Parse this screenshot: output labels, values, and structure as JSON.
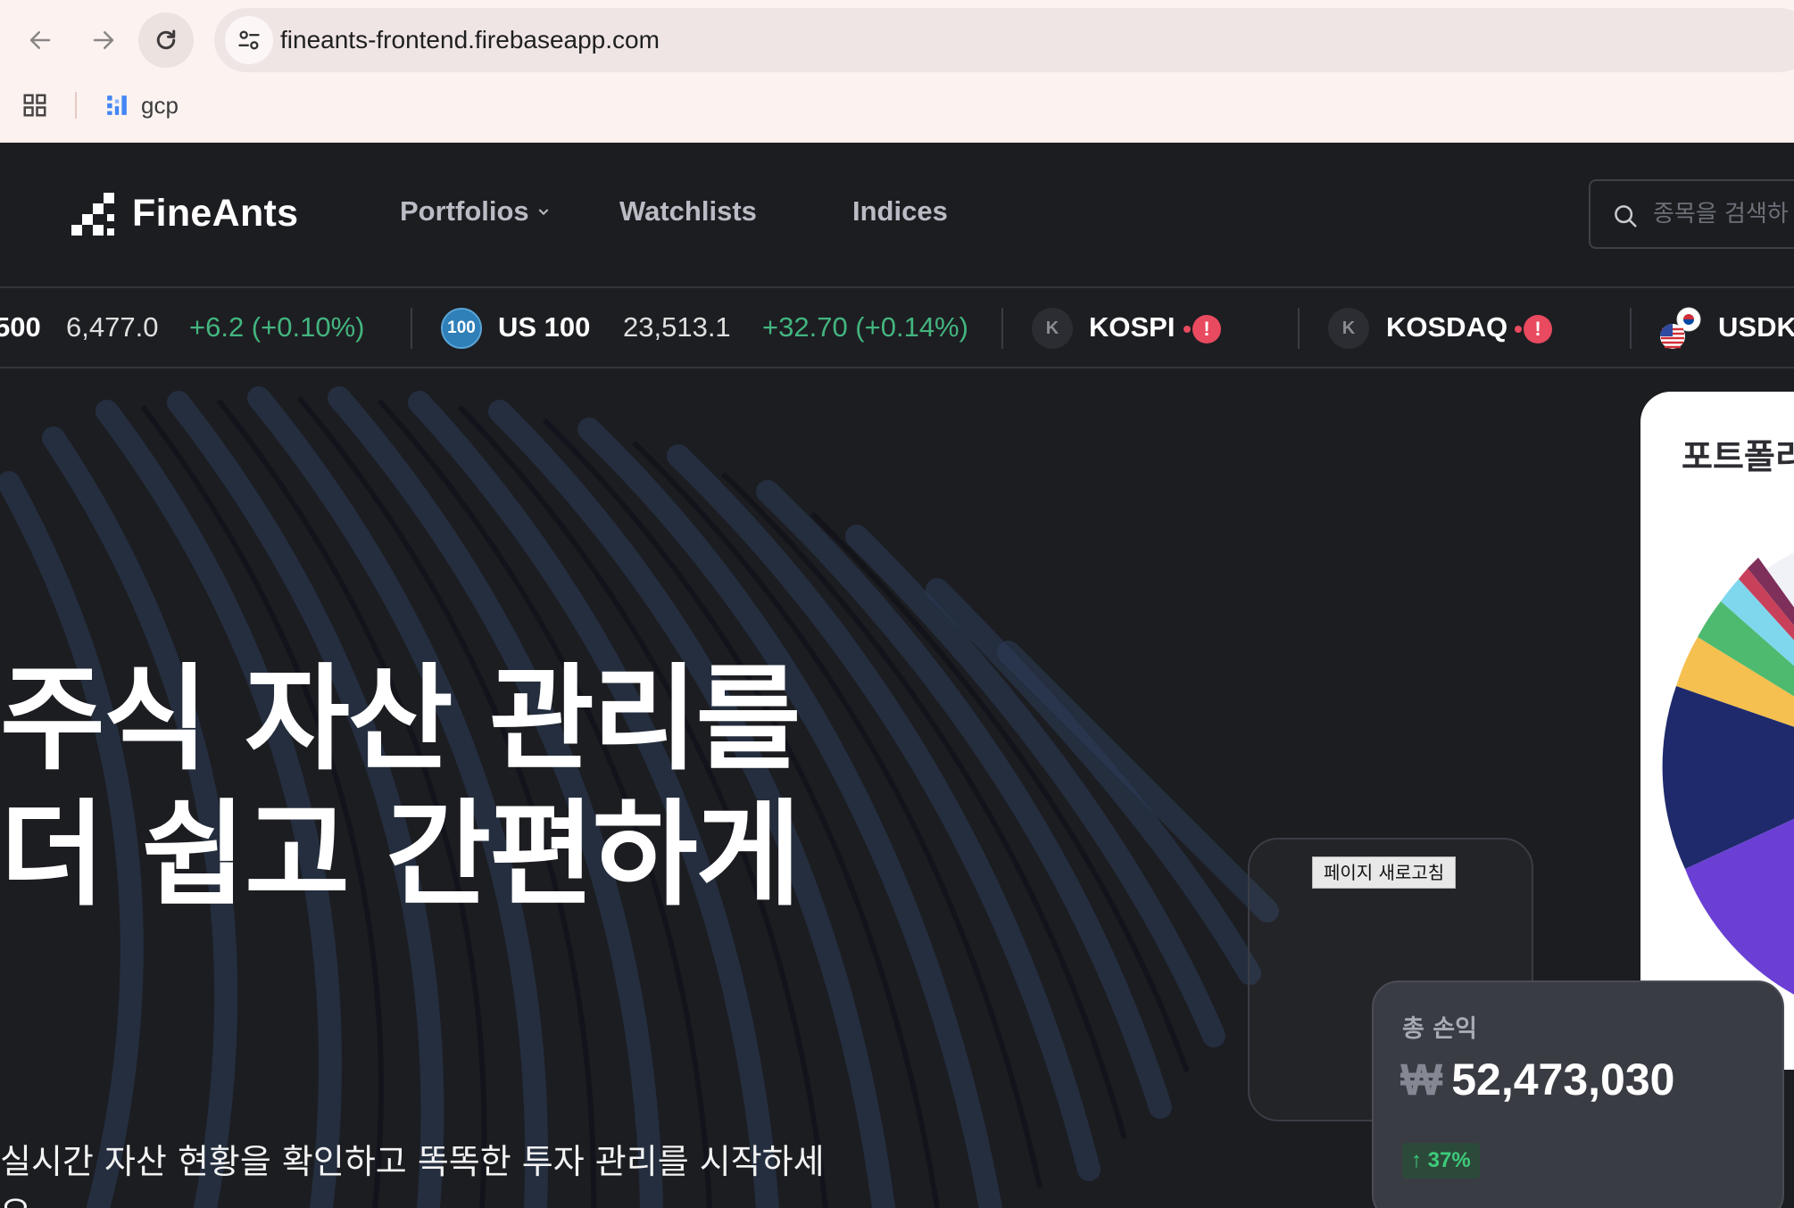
{
  "browser": {
    "url": "fineants-frontend.firebaseapp.com",
    "bookmarks": [
      {
        "label": "gcp"
      }
    ]
  },
  "header": {
    "logo_text": "FineAnts",
    "menu": [
      {
        "label": "Portfolios"
      },
      {
        "label": "Watchlists"
      },
      {
        "label": "Indices"
      }
    ],
    "search_placeholder": "종목을 검색하"
  },
  "ticker": [
    {
      "name": "500",
      "value": "6,477.0",
      "change": "+6.2 (+0.10%)"
    },
    {
      "badge": "100",
      "name": "US 100",
      "value": "23,513.1",
      "change": "+32.70 (+0.14%)"
    },
    {
      "badge": "K",
      "name": "KOSPI",
      "alert": "!"
    },
    {
      "badge": "K",
      "name": "KOSDAQ",
      "alert": "!"
    },
    {
      "name": "USDK"
    }
  ],
  "hero": {
    "title_line1": "주식 자산 관리를",
    "title_line2": "더 쉽고 간편하게",
    "subtitle_line1": "실시간 자산 현황을 확인하고 똑똑한 투자 관리를 시작하세",
    "subtitle_line2": "요"
  },
  "portfolio_card": {
    "title": "포트폴리"
  },
  "refresh_button": "페이지 새로고침",
  "pl_card": {
    "label": "총 손익",
    "currency": "₩",
    "value": "52,473,030",
    "badge": "↑ 37%"
  },
  "colors": {
    "page_bg": "#1c1d21",
    "ticker_positive": "#43b57f",
    "alert": "#e84a5f",
    "pl_positive": "#3dcb7a"
  }
}
